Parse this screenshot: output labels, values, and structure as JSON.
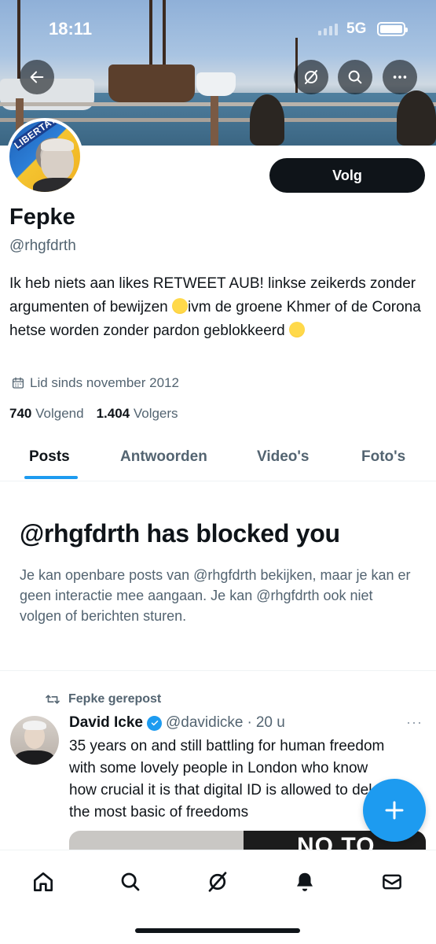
{
  "status_bar": {
    "time": "18:11",
    "network": "5G"
  },
  "header_actions": {
    "back_icon": "arrow-left-icon",
    "grok_icon": "slash-circle-icon",
    "search_icon": "search-icon",
    "more_icon": "more-horizontal-icon"
  },
  "profile": {
    "avatar_stamp": "LIBERTATE!",
    "name": "Fepke",
    "handle": "@rhgfdrth",
    "follow_label": "Volg",
    "bio_part1": "Ik heb niets aan likes RETWEET AUB! linkse zeikerds zonder argumenten of bewijzen ",
    "bio_part2": "ivm de groene Khmer of de Corona hetse worden zonder pardon geblokkeerd ",
    "joined": "Lid sinds november 2012",
    "following_count": "740",
    "following_label": "Volgend",
    "followers_count": "1.404",
    "followers_label": "Volgers"
  },
  "tabs": [
    {
      "label": "Posts",
      "active": true
    },
    {
      "label": "Antwoorden",
      "active": false
    },
    {
      "label": "Video's",
      "active": false
    },
    {
      "label": "Foto's",
      "active": false
    }
  ],
  "blocked": {
    "title": "@rhgfdrth has blocked you",
    "text": "Je kan openbare posts van @rhgfdrth bekijken, maar je kan er geen interactie mee aangaan. Je kan @rhgfdrth ook niet volgen of berichten sturen."
  },
  "post": {
    "repost_label": "Fepke gerepost",
    "author": "David Icke",
    "handle": "@davidicke",
    "separator": "·",
    "time": "20 u",
    "more": "···",
    "text": "35 years on and still battling for human freedom with some lovely people in London who know how crucial it is that digital ID is allowed to delete the most basic of freedoms",
    "media_text": "NO TO"
  },
  "fab": {
    "icon": "plus-icon"
  },
  "bottom_nav": [
    {
      "icon": "home-icon"
    },
    {
      "icon": "search-icon"
    },
    {
      "icon": "grok-icon"
    },
    {
      "icon": "bell-icon"
    },
    {
      "icon": "mail-icon"
    }
  ],
  "colors": {
    "accent": "#1d9bf0",
    "text": "#0f1419",
    "secondary": "#536471"
  }
}
